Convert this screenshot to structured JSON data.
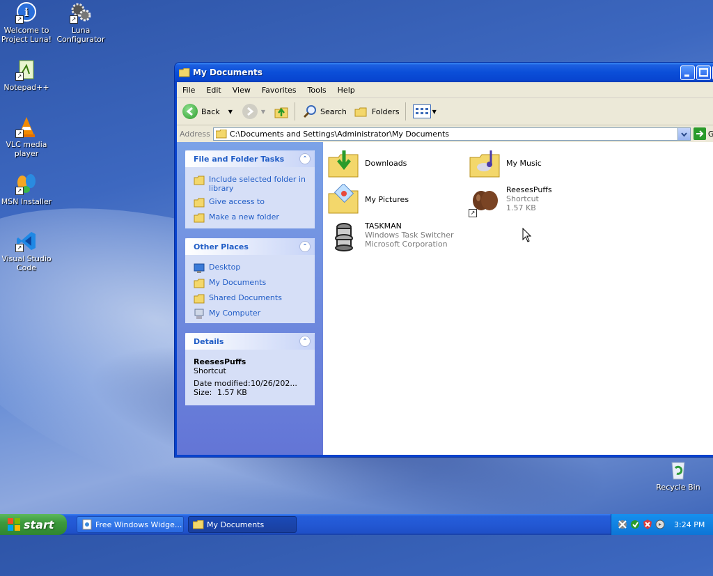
{
  "desktop": {
    "icons": [
      {
        "label_line1": "Welcome to",
        "label_line2": "Project Luna!"
      },
      {
        "label_line1": "Luna",
        "label_line2": "Configurator"
      },
      {
        "label_line1": "Notepad++",
        "label_line2": ""
      },
      {
        "label_line1": "VLC media",
        "label_line2": "player"
      },
      {
        "label_line1": "MSN Installer",
        "label_line2": ""
      },
      {
        "label_line1": "Visual Studio",
        "label_line2": "Code"
      },
      {
        "label_line1": "Recycle Bin",
        "label_line2": ""
      }
    ]
  },
  "window": {
    "title": "My Documents",
    "menu": [
      "File",
      "Edit",
      "View",
      "Favorites",
      "Tools",
      "Help"
    ],
    "toolbar": {
      "back": "Back",
      "search": "Search",
      "folders": "Folders"
    },
    "address": {
      "label": "Address",
      "value": "C:\\Documents and Settings\\Administrator\\My Documents",
      "go": "Go"
    },
    "left_pane": {
      "tasks": {
        "title": "File and Folder Tasks",
        "items": [
          "Include selected folder in library",
          "Give access to",
          "Make a new folder"
        ]
      },
      "places": {
        "title": "Other Places",
        "items": [
          "Desktop",
          "My Documents",
          "Shared Documents",
          "My Computer"
        ]
      },
      "details": {
        "title": "Details",
        "name": "ReesesPuffs",
        "type": "Shortcut",
        "modified_label": "Date modified:",
        "modified_value": "10/26/202...",
        "size_label": "Size:",
        "size_value": "1.57 KB"
      }
    },
    "files": [
      {
        "name": "Downloads",
        "line2": "",
        "line3": ""
      },
      {
        "name": "My Music",
        "line2": "",
        "line3": ""
      },
      {
        "name": "My Pictures",
        "line2": "",
        "line3": ""
      },
      {
        "name": "ReesesPuffs",
        "line2": "Shortcut",
        "line3": "1.57 KB"
      },
      {
        "name": "TASKMAN",
        "line2": "Windows Task Switcher",
        "line3": "Microsoft Corporation"
      }
    ]
  },
  "taskbar": {
    "start": "start",
    "tasks": [
      "Free Windows Widge...",
      "My Documents"
    ],
    "clock": "3:24 PM"
  },
  "colors": {
    "accent": "#0a4ed8",
    "link": "#215dc6",
    "start_green": "#3d9a3d"
  }
}
